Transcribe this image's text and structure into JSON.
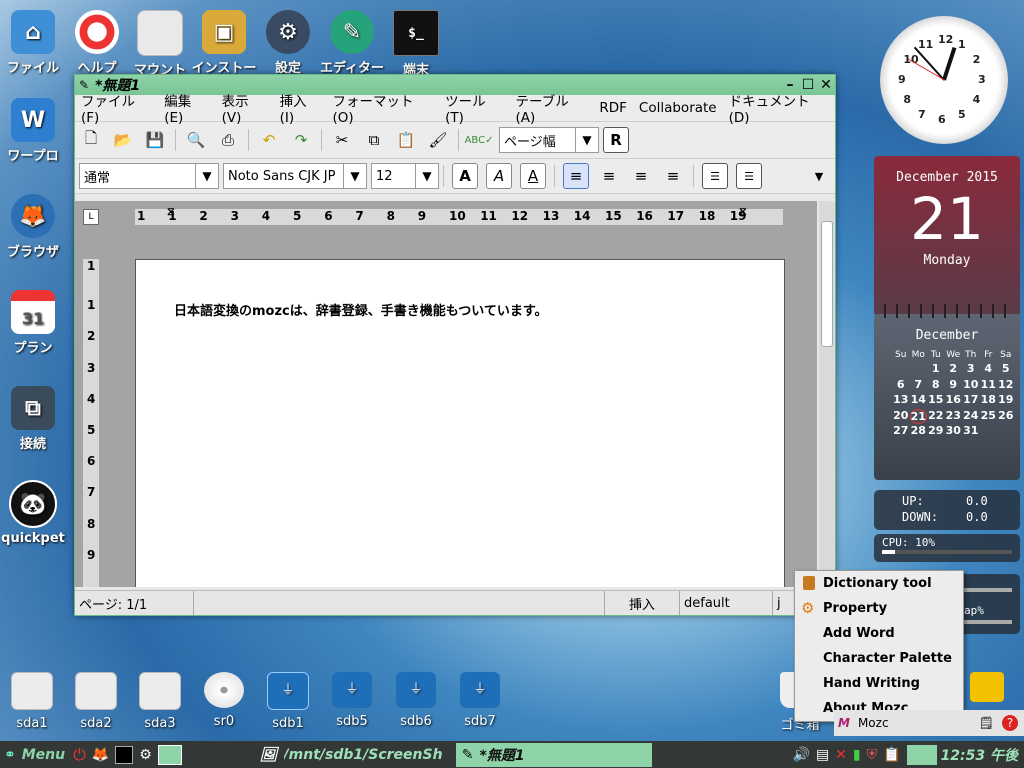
{
  "desktop": {
    "top_icons": [
      {
        "label": "ファイル",
        "icon": "home-icon"
      },
      {
        "label": "ヘルプ",
        "icon": "lifebuoy-icon"
      },
      {
        "label": "マウント",
        "icon": "drive-icon"
      },
      {
        "label": "インストール",
        "icon": "package-icon"
      },
      {
        "label": "設定",
        "icon": "gear-icon"
      },
      {
        "label": "エディター",
        "icon": "pen-icon"
      },
      {
        "label": "端末",
        "icon": "terminal-icon"
      }
    ],
    "left_icons": [
      {
        "label": "ワープロ",
        "icon": "word-icon"
      },
      {
        "label": "ブラウザ",
        "icon": "browser-icon"
      },
      {
        "label": "プラン",
        "icon": "calendar-icon",
        "badge": "31"
      },
      {
        "label": "接続",
        "icon": "network-icon"
      },
      {
        "label": "quickpet",
        "icon": "quickpet-icon"
      }
    ],
    "drives": [
      "sda1",
      "sda2",
      "sda3",
      "sr0",
      "sdb1",
      "sdb5",
      "sdb6",
      "sdb7"
    ],
    "trash_label": "ゴミ箱"
  },
  "window": {
    "title": "*無題1",
    "menu": [
      "ファイル(F)",
      "編集(E)",
      "表示(V)",
      "挿入(I)",
      "フォーマット(O)",
      "ツール(T)",
      "テーブル(A)",
      "RDF",
      "Collaborate",
      "ドキュメント(D)"
    ],
    "zoom_value": "ページ幅",
    "style_value": "通常",
    "font_value": "Noto Sans CJK JP",
    "size_value": "12",
    "ruler_ticks": [
      "1",
      "1",
      "2",
      "3",
      "4",
      "5",
      "6",
      "7",
      "8",
      "9",
      "10",
      "11",
      "12",
      "13",
      "14",
      "15",
      "16",
      "17",
      "18",
      "19"
    ],
    "vruler_ticks": [
      "1",
      "1",
      "2",
      "3",
      "4",
      "5",
      "6",
      "7",
      "8",
      "9"
    ],
    "document_text": "日本語変換のmozcは、辞書登録、手書き機能もついています。",
    "status": {
      "page": "ページ: 1/1",
      "mode": "挿入",
      "lang": "default",
      "extra": "j"
    }
  },
  "widgets": {
    "clock_numbers": [
      "12",
      "1",
      "2",
      "3",
      "4",
      "5",
      "6",
      "7",
      "8",
      "9",
      "10",
      "11"
    ],
    "month_year": "December 2015",
    "day": "21",
    "weekday": "Monday",
    "cal_month": "December",
    "cal_headers": [
      "Su",
      "Mo",
      "Tu",
      "We",
      "Th",
      "Fr",
      "Sa"
    ],
    "cal_weeks": [
      [
        "",
        "",
        "1",
        "2",
        "3",
        "4",
        "5"
      ],
      [
        "6",
        "7",
        "8",
        "9",
        "10",
        "11",
        "12"
      ],
      [
        "13",
        "14",
        "15",
        "16",
        "17",
        "18",
        "19"
      ],
      [
        "20",
        "21",
        "22",
        "23",
        "24",
        "25",
        "26"
      ],
      [
        "27",
        "28",
        "29",
        "30",
        "31",
        "",
        ""
      ]
    ],
    "up_label": "UP:",
    "up_value": "0.0",
    "down_label": "DOWN:",
    "down_value": "0.0",
    "cpu_label": "CPU: 10%",
    "cpu_fraction": 0.1,
    "swap_label": "ap%"
  },
  "popup_menu": [
    "Dictionary tool",
    "Property",
    "Add Word",
    "Character Palette",
    "Hand Writing",
    "About Mozc"
  ],
  "taskbar": {
    "menu_label": "Menu",
    "tasks": [
      "/mnt/sdb1/ScreenSh",
      "*無題1"
    ],
    "clock": "12:53 午後",
    "tray_mozc": "Mozc"
  }
}
